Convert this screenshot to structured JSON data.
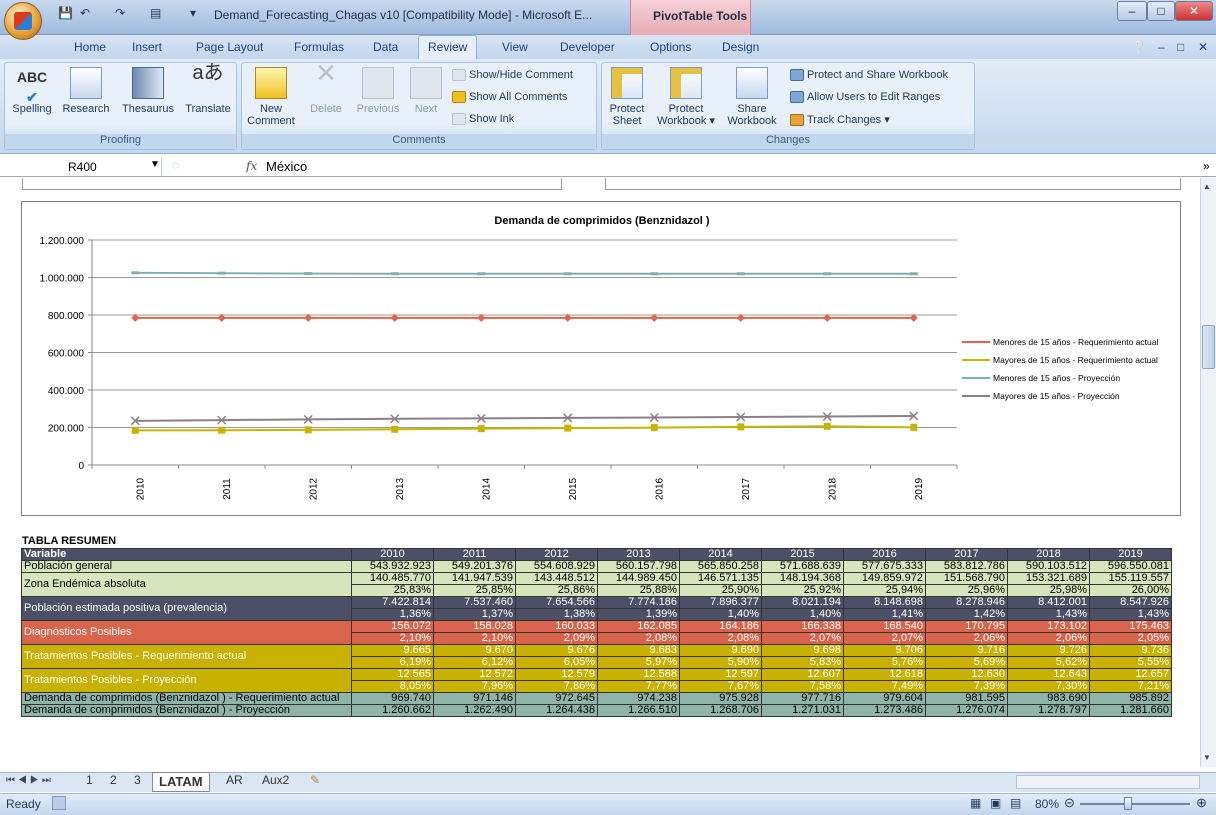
{
  "window": {
    "title": "Demand_Forecasting_Chagas v10  [Compatibility Mode] - Microsoft E...",
    "context_tab": "PivotTable Tools"
  },
  "tabs": [
    "Home",
    "Insert",
    "Page Layout",
    "Formulas",
    "Data",
    "Review",
    "View",
    "Developer",
    "Options",
    "Design"
  ],
  "ribbon": {
    "proofing": {
      "label": "Proofing",
      "spelling": "Spelling",
      "research": "Research",
      "thesaurus": "Thesaurus",
      "translate": "Translate"
    },
    "comments": {
      "label": "Comments",
      "new": "New",
      "new2": "Comment",
      "delete": "Delete",
      "previous": "Previous",
      "next": "Next",
      "show_hide": "Show/Hide Comment",
      "show_all": "Show All Comments",
      "show_ink": "Show Ink"
    },
    "changes": {
      "label": "Changes",
      "protect_sheet": "Protect",
      "protect_sheet2": "Sheet",
      "protect_wb": "Protect",
      "protect_wb2": "Workbook",
      "share_wb": "Share",
      "share_wb2": "Workbook",
      "protect_share": "Protect and Share Workbook",
      "allow_edit": "Allow Users to Edit Ranges",
      "track": "Track Changes"
    }
  },
  "formula": {
    "cell": "R400",
    "fx": "fx",
    "value": "México"
  },
  "chart_data": {
    "type": "line",
    "title": "Demanda de comprimidos (Benznidazol )",
    "categories": [
      "2010",
      "2011",
      "2012",
      "2013",
      "2014",
      "2015",
      "2016",
      "2017",
      "2018",
      "2019"
    ],
    "ylim": [
      0,
      1200000
    ],
    "yticks": [
      "0",
      "200.000",
      "400.000",
      "600.000",
      "800.000",
      "1.000.000",
      "1.200.000"
    ],
    "legend": "right",
    "series": [
      {
        "name": "Menores de 15 años - Requerimiento actual",
        "color": "#e2634a",
        "values": [
          785000,
          785000,
          785000,
          785000,
          785000,
          785000,
          785000,
          785000,
          785000,
          785000
        ]
      },
      {
        "name": "Mayores de 15 años - Requerimiento actual",
        "color": "#c8b400",
        "values": [
          184675,
          185506,
          187612,
          190555,
          193818,
          196702,
          199534,
          203134,
          206580,
          200677
        ]
      },
      {
        "name": "Menores de 15 años - Proyección",
        "color": "#7fafb0",
        "values": [
          1025000,
          1023000,
          1021000,
          1020000,
          1020000,
          1020000,
          1020000,
          1020000,
          1020000,
          1020000
        ]
      },
      {
        "name": "Mayores de 15 años - Proyección",
        "color": "#8c7f88",
        "values": [
          235662,
          239490,
          243438,
          246510,
          248706,
          251031,
          253486,
          256074,
          258797,
          261660
        ]
      }
    ]
  },
  "table": {
    "title": "TABLA RESUMEN",
    "header": "Variable",
    "years": [
      "2010",
      "2011",
      "2012",
      "2013",
      "2014",
      "2015",
      "2016",
      "2017",
      "2018",
      "2019"
    ],
    "rows": {
      "poblacion": {
        "label": "Población general",
        "v": [
          "543.932.923",
          "549.201.376",
          "554.608.929",
          "560.157.798",
          "565.850.258",
          "571.688.639",
          "577.675.333",
          "583.812.786",
          "590.103.512",
          "596.550.081"
        ]
      },
      "zona": {
        "label": "Zona Endémica absoluta",
        "v": [
          "140.485.770",
          "141.947.539",
          "143.448.512",
          "144.989.450",
          "146.571.135",
          "148.194.368",
          "149.859.972",
          "151.568.790",
          "153.321.689",
          "155.119.557"
        ],
        "p": [
          "25,83%",
          "25,85%",
          "25,86%",
          "25,88%",
          "25,90%",
          "25,92%",
          "25,94%",
          "25,96%",
          "25,98%",
          "26,00%"
        ]
      },
      "estimada": {
        "label": "Población estimada positiva (prevalencia)",
        "v": [
          "7.422.814",
          "7.537.460",
          "7.654.566",
          "7.774.186",
          "7.896.377",
          "8.021.194",
          "8.148.698",
          "8.278.946",
          "8.412.001",
          "8.547.926"
        ],
        "p": [
          "1,36%",
          "1,37%",
          "1,38%",
          "1,39%",
          "1,40%",
          "1,40%",
          "1,41%",
          "1,42%",
          "1,43%",
          "1,43%"
        ]
      },
      "diag": {
        "label": "Diagnósticos Posibles",
        "v": [
          "156.072",
          "158.028",
          "160.033",
          "162.085",
          "164.186",
          "166.338",
          "168.540",
          "170.795",
          "173.102",
          "175.463"
        ],
        "p": [
          "2,10%",
          "2,10%",
          "2,09%",
          "2,08%",
          "2,08%",
          "2,07%",
          "2,07%",
          "2,06%",
          "2,06%",
          "2,05%"
        ]
      },
      "trat_req": {
        "label": "Tratamientos Posibles - Requerimiento actual",
        "v": [
          "9.665",
          "9.670",
          "9.676",
          "9.683",
          "9.690",
          "9.698",
          "9.706",
          "9.716",
          "9.726",
          "9.736"
        ],
        "p": [
          "6,19%",
          "6,12%",
          "6,05%",
          "5,97%",
          "5,90%",
          "5,83%",
          "5,76%",
          "5,69%",
          "5,62%",
          "5,55%"
        ]
      },
      "trat_proy": {
        "label": "Tratamientos Posibles - Proyección",
        "v": [
          "12.565",
          "12.572",
          "12.579",
          "12.588",
          "12.597",
          "12.607",
          "12.618",
          "12.630",
          "12.643",
          "12.657"
        ],
        "p": [
          "8,05%",
          "7,96%",
          "7,86%",
          "7,77%",
          "7,67%",
          "7,58%",
          "7,49%",
          "7,39%",
          "7,30%",
          "7,21%"
        ]
      },
      "dem_req": {
        "label": "Demanda de comprimidos (Benznidazol ) - Requerimiento actual",
        "v": [
          "969.740",
          "971.146",
          "972.645",
          "974.238",
          "975.928",
          "977.716",
          "979.604",
          "981.595",
          "983.690",
          "985.892"
        ]
      },
      "dem_proy": {
        "label": "Demanda de comprimidos (Benznidazol ) - Proyección",
        "v": [
          "1.260.662",
          "1.262.490",
          "1.264.438",
          "1.266.510",
          "1.268.706",
          "1.271.031",
          "1.273.486",
          "1.276.074",
          "1.278.797",
          "1.281.660"
        ]
      }
    }
  },
  "sheets": [
    "1",
    "2",
    "3",
    "LATAM",
    "AR",
    "Aux2"
  ],
  "status": {
    "ready": "Ready",
    "zoom": "80%"
  }
}
